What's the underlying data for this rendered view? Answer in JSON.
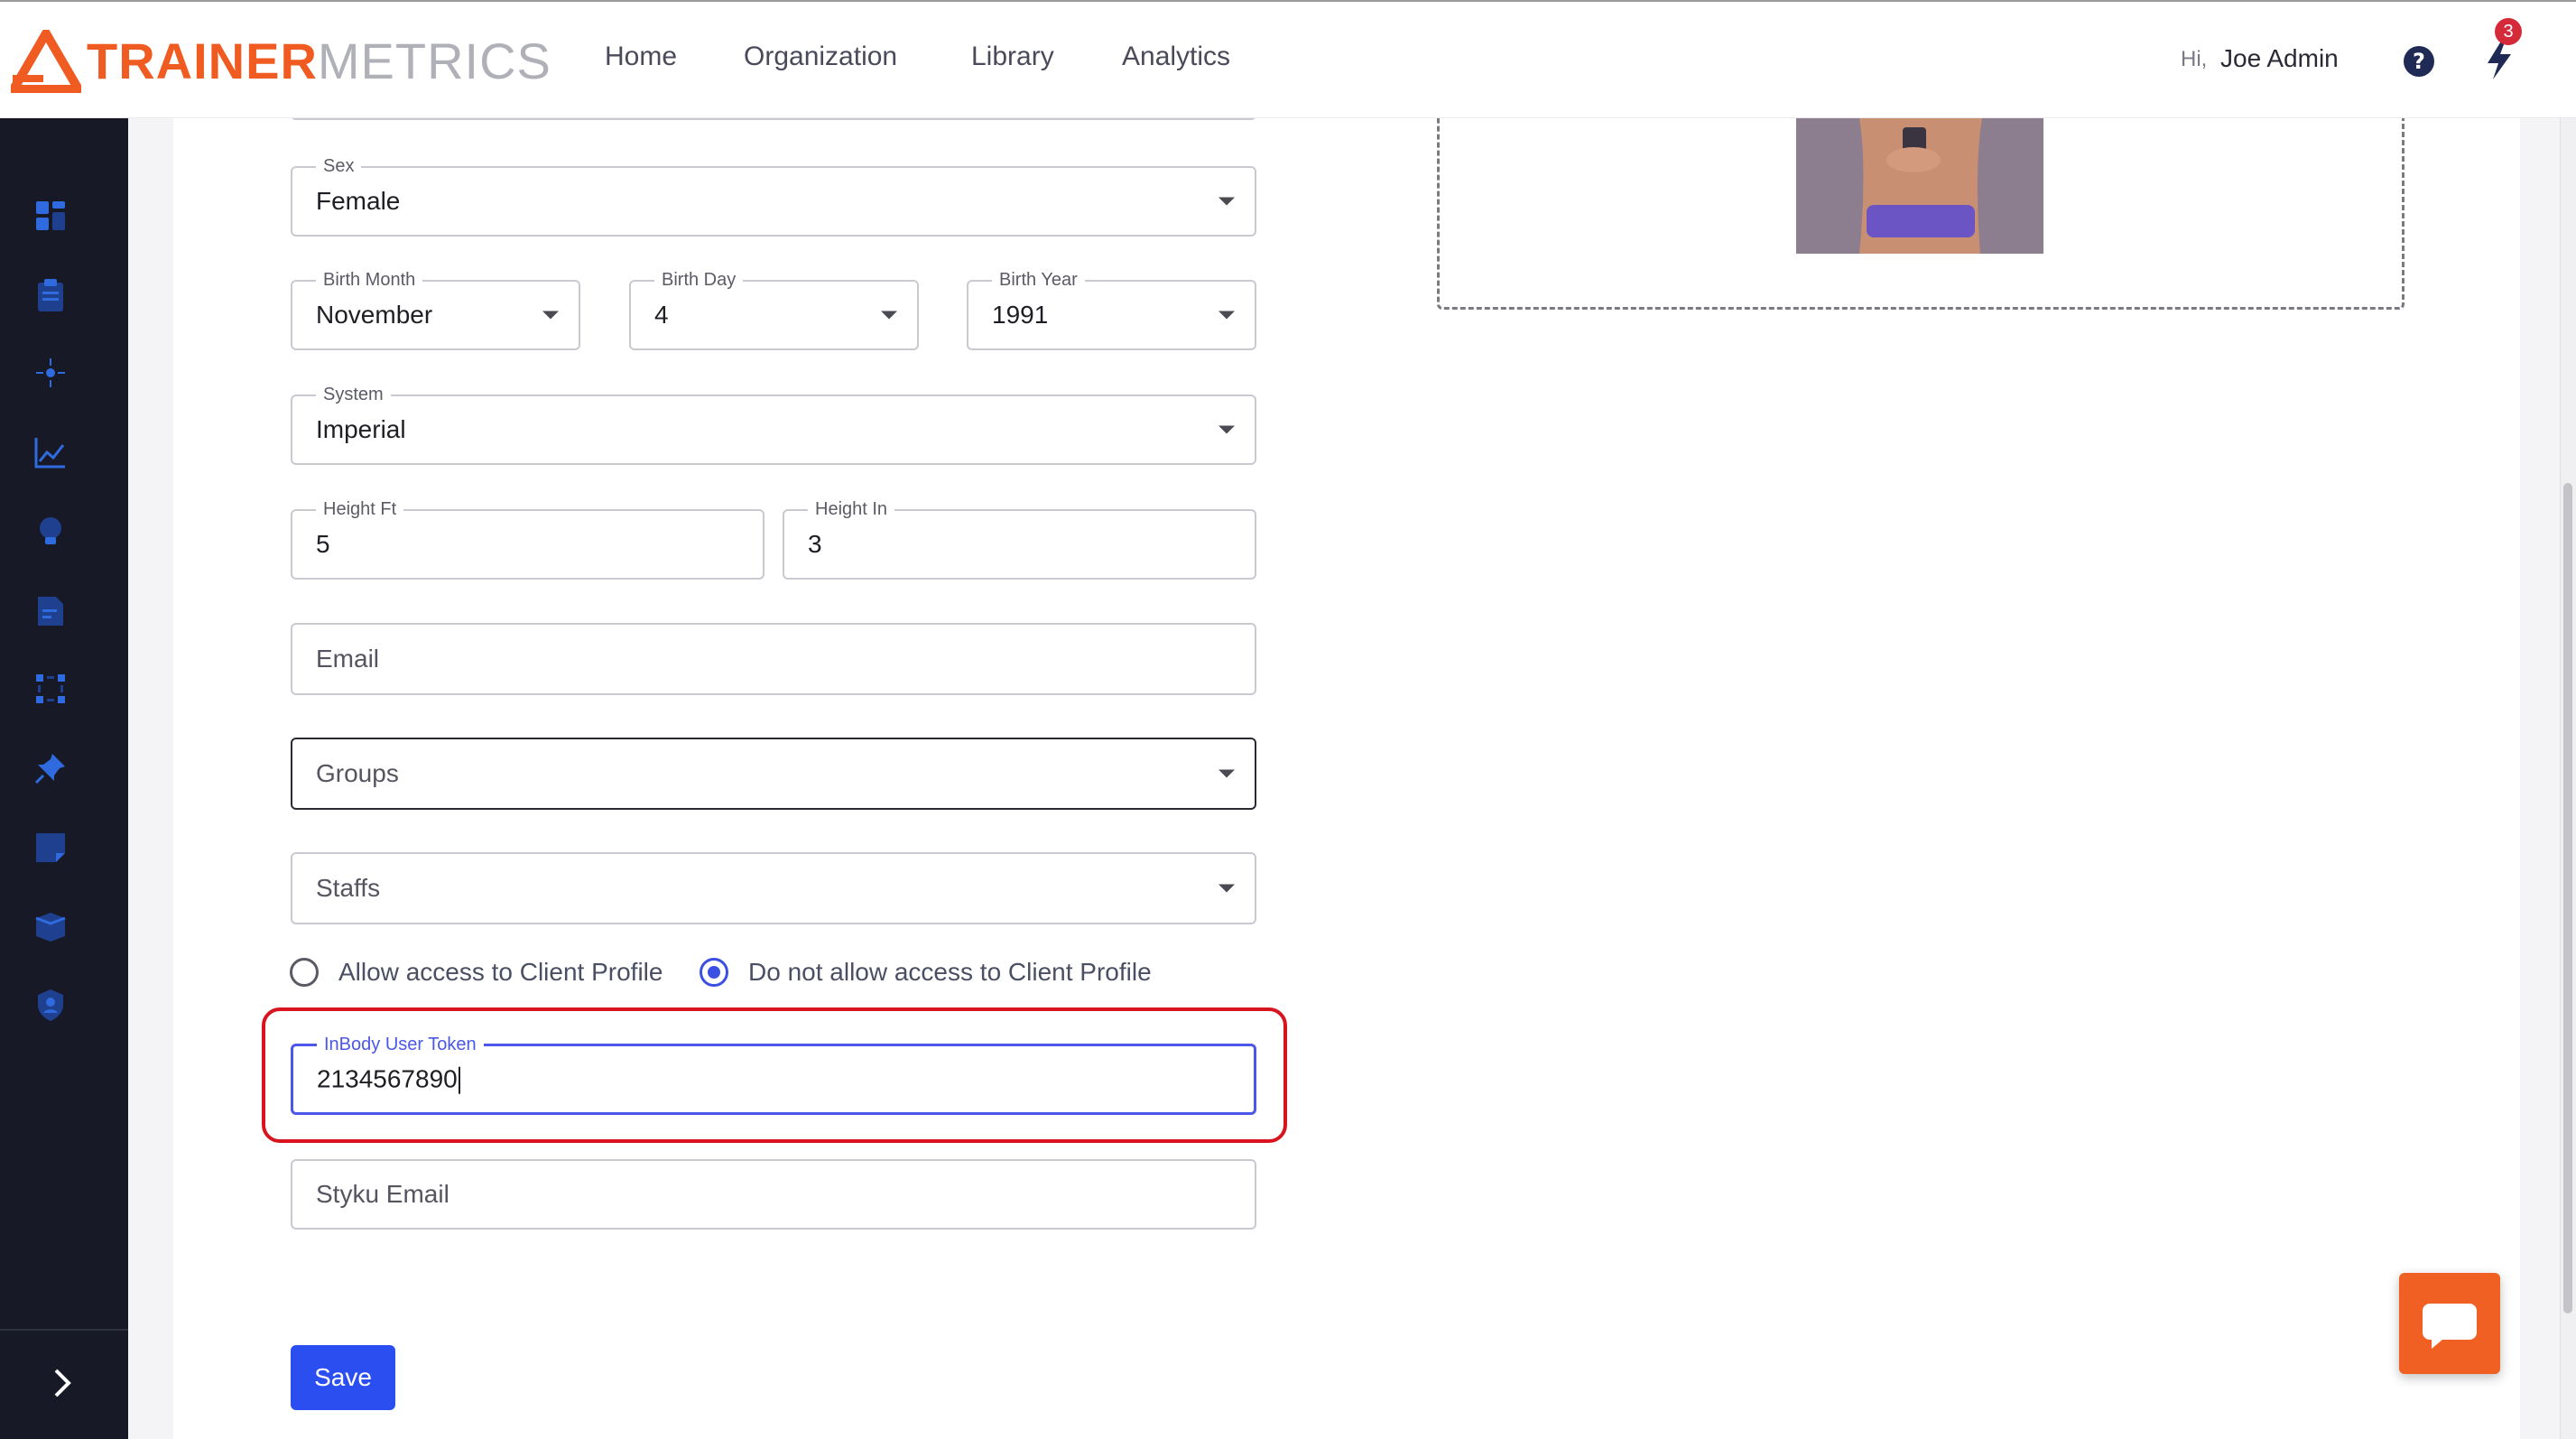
{
  "brand": {
    "bold": "TRAINER",
    "light": "METRICS",
    "accent": "#ef5b20"
  },
  "nav": {
    "items": [
      "Home",
      "Organization",
      "Library",
      "Analytics"
    ]
  },
  "header": {
    "greeting": "Hi,",
    "user_name": "Joe Admin",
    "notification_count": "3",
    "help_icon": "question-circle-icon",
    "notification_icon": "lightning-bolt-icon"
  },
  "sidebar": {
    "icons": [
      "dashboard-icon",
      "clipboard-icon",
      "settings-icon",
      "chart-line-icon",
      "lightbulb-icon",
      "document-icon",
      "grid-dots-icon",
      "pin-icon",
      "note-icon",
      "box-icon",
      "shield-user-icon"
    ],
    "toggle_icon": "chevron-right-icon"
  },
  "form": {
    "sex": {
      "label": "Sex",
      "value": "Female"
    },
    "birth_month": {
      "label": "Birth Month",
      "value": "November"
    },
    "birth_day": {
      "label": "Birth Day",
      "value": "4"
    },
    "birth_year": {
      "label": "Birth Year",
      "value": "1991"
    },
    "system": {
      "label": "System",
      "value": "Imperial"
    },
    "height_ft": {
      "label": "Height Ft",
      "value": "5"
    },
    "height_in": {
      "label": "Height In",
      "value": "3"
    },
    "email": {
      "placeholder": "Email"
    },
    "groups": {
      "placeholder": "Groups"
    },
    "staffs": {
      "placeholder": "Staffs"
    },
    "access": {
      "allow_label": "Allow access to Client Profile",
      "deny_label": "Do not allow access to Client Profile",
      "selected": "deny"
    },
    "inbody_token": {
      "label": "InBody User Token",
      "value": "2134567890"
    },
    "styku_email": {
      "placeholder": "Styku Email"
    },
    "save_label": "Save"
  },
  "colors": {
    "primary": "#2b4ef0",
    "focus": "#4a57e8",
    "highlight": "#d8141f",
    "chat": "#f06022",
    "sidebar_bg": "#171a26",
    "sidebar_icon": "#2f6bde"
  }
}
